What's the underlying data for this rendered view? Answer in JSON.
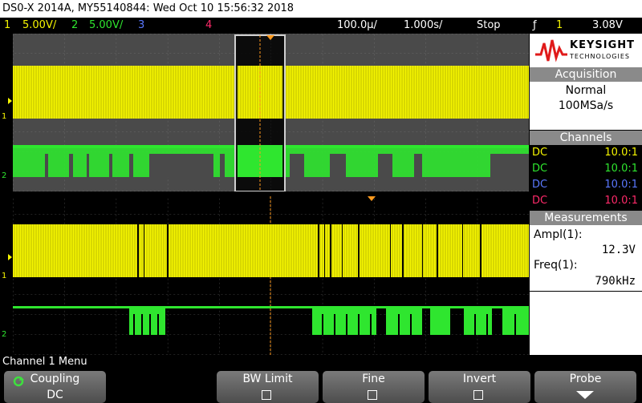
{
  "window": {
    "title": "DS0-X 2014A, MY55140844: Wed Oct 10 15:56:32 2018"
  },
  "status": {
    "ch1_num": "1",
    "ch1_scale": "5.00V/",
    "ch2_num": "2",
    "ch2_scale": "5.00V/",
    "ch3_num": "3",
    "ch4_num": "4",
    "timebase": "100.0µ/",
    "delay": "1.000s/",
    "run_state": "Stop",
    "trigger_icon": "ƒ",
    "trigger_src": "1",
    "trigger_level": "3.08V"
  },
  "logo": {
    "brand": "KEYSIGHT",
    "sub": "TECHNOLOGIES"
  },
  "acquisition": {
    "title": "Acquisition",
    "mode": "Normal",
    "rate": "100MSa/s"
  },
  "channels": {
    "title": "Channels",
    "rows": [
      {
        "coupling": "DC",
        "probe": "10.0:1",
        "color": "#f5f500"
      },
      {
        "coupling": "DC",
        "probe": "10.0:1",
        "color": "#2fe62f"
      },
      {
        "coupling": "DC",
        "probe": "10.0:1",
        "color": "#5a78ff"
      },
      {
        "coupling": "DC",
        "probe": "10.0:1",
        "color": "#ff2a6a"
      }
    ]
  },
  "measurements": {
    "title": "Measurements",
    "m1_label": "Ampl(1):",
    "m1_value": "12.3V",
    "m2_label": "Freq(1):",
    "m2_value": "790kHz"
  },
  "menu": {
    "title": "Channel 1 Menu"
  },
  "softkeys": {
    "coupling_label": "Coupling",
    "coupling_value": "DC",
    "bw_label": "BW Limit",
    "fine_label": "Fine",
    "invert_label": "Invert",
    "probe_label": "Probe"
  },
  "colors": {
    "ch1": "#f5f500",
    "ch2": "#2fe62f",
    "ch3": "#5a78ff",
    "ch4": "#ff2a6a",
    "trigger_marker": "#ff9a1e",
    "grid_bg": "#4a4a4a"
  }
}
